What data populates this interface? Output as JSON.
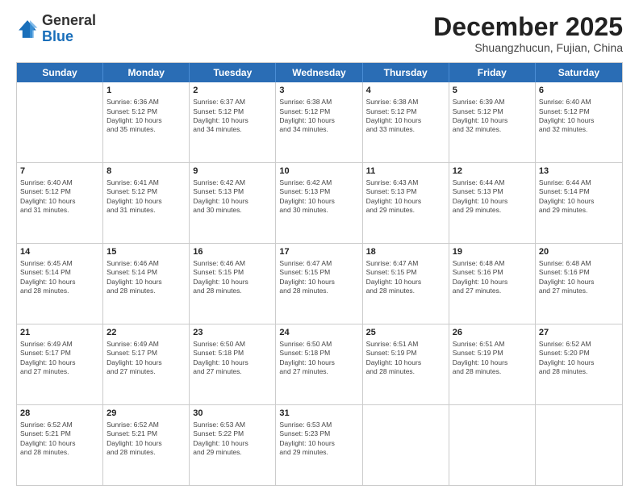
{
  "logo": {
    "general": "General",
    "blue": "Blue"
  },
  "header": {
    "month": "December 2025",
    "location": "Shuangzhucun, Fujian, China"
  },
  "weekdays": [
    "Sunday",
    "Monday",
    "Tuesday",
    "Wednesday",
    "Thursday",
    "Friday",
    "Saturday"
  ],
  "weeks": [
    [
      {
        "day": "",
        "info": ""
      },
      {
        "day": "1",
        "info": "Sunrise: 6:36 AM\nSunset: 5:12 PM\nDaylight: 10 hours\nand 35 minutes."
      },
      {
        "day": "2",
        "info": "Sunrise: 6:37 AM\nSunset: 5:12 PM\nDaylight: 10 hours\nand 34 minutes."
      },
      {
        "day": "3",
        "info": "Sunrise: 6:38 AM\nSunset: 5:12 PM\nDaylight: 10 hours\nand 34 minutes."
      },
      {
        "day": "4",
        "info": "Sunrise: 6:38 AM\nSunset: 5:12 PM\nDaylight: 10 hours\nand 33 minutes."
      },
      {
        "day": "5",
        "info": "Sunrise: 6:39 AM\nSunset: 5:12 PM\nDaylight: 10 hours\nand 32 minutes."
      },
      {
        "day": "6",
        "info": "Sunrise: 6:40 AM\nSunset: 5:12 PM\nDaylight: 10 hours\nand 32 minutes."
      }
    ],
    [
      {
        "day": "7",
        "info": "Sunrise: 6:40 AM\nSunset: 5:12 PM\nDaylight: 10 hours\nand 31 minutes."
      },
      {
        "day": "8",
        "info": "Sunrise: 6:41 AM\nSunset: 5:12 PM\nDaylight: 10 hours\nand 31 minutes."
      },
      {
        "day": "9",
        "info": "Sunrise: 6:42 AM\nSunset: 5:13 PM\nDaylight: 10 hours\nand 30 minutes."
      },
      {
        "day": "10",
        "info": "Sunrise: 6:42 AM\nSunset: 5:13 PM\nDaylight: 10 hours\nand 30 minutes."
      },
      {
        "day": "11",
        "info": "Sunrise: 6:43 AM\nSunset: 5:13 PM\nDaylight: 10 hours\nand 29 minutes."
      },
      {
        "day": "12",
        "info": "Sunrise: 6:44 AM\nSunset: 5:13 PM\nDaylight: 10 hours\nand 29 minutes."
      },
      {
        "day": "13",
        "info": "Sunrise: 6:44 AM\nSunset: 5:14 PM\nDaylight: 10 hours\nand 29 minutes."
      }
    ],
    [
      {
        "day": "14",
        "info": "Sunrise: 6:45 AM\nSunset: 5:14 PM\nDaylight: 10 hours\nand 28 minutes."
      },
      {
        "day": "15",
        "info": "Sunrise: 6:46 AM\nSunset: 5:14 PM\nDaylight: 10 hours\nand 28 minutes."
      },
      {
        "day": "16",
        "info": "Sunrise: 6:46 AM\nSunset: 5:15 PM\nDaylight: 10 hours\nand 28 minutes."
      },
      {
        "day": "17",
        "info": "Sunrise: 6:47 AM\nSunset: 5:15 PM\nDaylight: 10 hours\nand 28 minutes."
      },
      {
        "day": "18",
        "info": "Sunrise: 6:47 AM\nSunset: 5:15 PM\nDaylight: 10 hours\nand 28 minutes."
      },
      {
        "day": "19",
        "info": "Sunrise: 6:48 AM\nSunset: 5:16 PM\nDaylight: 10 hours\nand 27 minutes."
      },
      {
        "day": "20",
        "info": "Sunrise: 6:48 AM\nSunset: 5:16 PM\nDaylight: 10 hours\nand 27 minutes."
      }
    ],
    [
      {
        "day": "21",
        "info": "Sunrise: 6:49 AM\nSunset: 5:17 PM\nDaylight: 10 hours\nand 27 minutes."
      },
      {
        "day": "22",
        "info": "Sunrise: 6:49 AM\nSunset: 5:17 PM\nDaylight: 10 hours\nand 27 minutes."
      },
      {
        "day": "23",
        "info": "Sunrise: 6:50 AM\nSunset: 5:18 PM\nDaylight: 10 hours\nand 27 minutes."
      },
      {
        "day": "24",
        "info": "Sunrise: 6:50 AM\nSunset: 5:18 PM\nDaylight: 10 hours\nand 27 minutes."
      },
      {
        "day": "25",
        "info": "Sunrise: 6:51 AM\nSunset: 5:19 PM\nDaylight: 10 hours\nand 28 minutes."
      },
      {
        "day": "26",
        "info": "Sunrise: 6:51 AM\nSunset: 5:19 PM\nDaylight: 10 hours\nand 28 minutes."
      },
      {
        "day": "27",
        "info": "Sunrise: 6:52 AM\nSunset: 5:20 PM\nDaylight: 10 hours\nand 28 minutes."
      }
    ],
    [
      {
        "day": "28",
        "info": "Sunrise: 6:52 AM\nSunset: 5:21 PM\nDaylight: 10 hours\nand 28 minutes."
      },
      {
        "day": "29",
        "info": "Sunrise: 6:52 AM\nSunset: 5:21 PM\nDaylight: 10 hours\nand 28 minutes."
      },
      {
        "day": "30",
        "info": "Sunrise: 6:53 AM\nSunset: 5:22 PM\nDaylight: 10 hours\nand 29 minutes."
      },
      {
        "day": "31",
        "info": "Sunrise: 6:53 AM\nSunset: 5:23 PM\nDaylight: 10 hours\nand 29 minutes."
      },
      {
        "day": "",
        "info": ""
      },
      {
        "day": "",
        "info": ""
      },
      {
        "day": "",
        "info": ""
      }
    ]
  ]
}
